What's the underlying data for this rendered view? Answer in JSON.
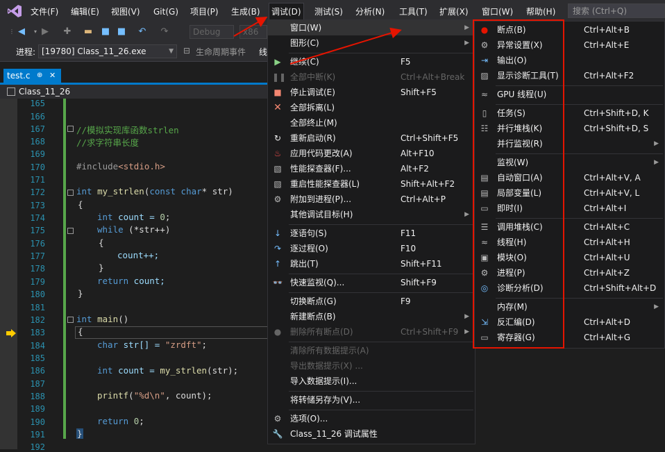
{
  "menubar": {
    "items": [
      "文件(F)",
      "编辑(E)",
      "视图(V)",
      "Git(G)",
      "项目(P)",
      "生成(B)",
      "调试(D)",
      "测试(S)",
      "分析(N)",
      "工具(T)",
      "扩展(X)",
      "窗口(W)",
      "帮助(H)"
    ],
    "search_placeholder": "搜索 (Ctrl+Q)"
  },
  "toolbar": {
    "config": "Debug",
    "platform": "x86",
    "process_label": "进程:",
    "process_value": "[19780] Class_11_26.exe",
    "lifecycle": "生命周期事件",
    "thread_label": "线"
  },
  "editor": {
    "tab_name": "test.c",
    "pin": "⊕",
    "close": "✕",
    "scope": "Class_11_26",
    "line_numbers": [
      "165",
      "166",
      "167",
      "168",
      "169",
      "170",
      "171",
      "172",
      "173",
      "174",
      "175",
      "176",
      "177",
      "178",
      "179",
      "180",
      "181",
      "182",
      "183",
      "184",
      "185",
      "186",
      "187",
      "188",
      "189",
      "190",
      "191",
      "192"
    ],
    "code": {
      "l167": "//模拟实现库函数strlen",
      "l168": "//求字符串长度",
      "l170_a": "#include",
      "l170_b": "<stdio.h>",
      "l172_kw": "int",
      "l172_fn": " my_strlen",
      "l172_rest": "(",
      "l172_kw2": "const",
      "l172_kw3": " char",
      "l172_end": "* str)",
      "l173": "{",
      "l174_kw": "int",
      "l174_rest": " count = ",
      "l174_num": "0",
      "l174_end": ";",
      "l175_kw": "while",
      "l175_rest": " (*str++)",
      "l176": "{",
      "l177": "count++;",
      "l178": "}",
      "l179_kw": "return",
      "l179_rest": " count;",
      "l180": "}",
      "l182_kw": "int",
      "l182_fn": " main",
      "l182_rest": "()",
      "l183": "{",
      "l184_kw": "char",
      "l184_rest": " str[] = ",
      "l184_str": "\"zrdft\"",
      "l184_end": ";",
      "l186_kw": "int",
      "l186_rest": " count = ",
      "l186_fn": "my_strlen",
      "l186_end": "(str);",
      "l188_fn": "printf",
      "l188_a": "(",
      "l188_str": "\"%d\\n\"",
      "l188_end": ", count);",
      "l190_kw": "return",
      "l190_rest": " ",
      "l190_num": "0",
      "l190_end": ";",
      "l191": "}"
    }
  },
  "debug_menu": {
    "items": [
      {
        "label": "窗口(W)",
        "shortcut": "",
        "icon": "",
        "submenu": true,
        "state": "highlighted"
      },
      {
        "label": "图形(C)",
        "shortcut": "",
        "icon": "",
        "submenu": true,
        "state": "normal"
      },
      {
        "label": "继续(C)",
        "shortcut": "F5",
        "icon": "play-icon",
        "state": "normal"
      },
      {
        "label": "全部中断(K)",
        "shortcut": "Ctrl+Alt+Break",
        "icon": "pause-icon",
        "state": "disabled"
      },
      {
        "label": "停止调试(E)",
        "shortcut": "Shift+F5",
        "icon": "stop-icon",
        "state": "normal"
      },
      {
        "label": "全部拆离(L)",
        "shortcut": "",
        "icon": "detach-icon",
        "state": "normal"
      },
      {
        "label": "全部终止(M)",
        "shortcut": "",
        "icon": "",
        "state": "normal"
      },
      {
        "label": "重新启动(R)",
        "shortcut": "Ctrl+Shift+F5",
        "icon": "restart-icon",
        "state": "normal"
      },
      {
        "label": "应用代码更改(A)",
        "shortcut": "Alt+F10",
        "icon": "hot-reload-icon",
        "state": "normal"
      },
      {
        "label": "性能探查器(F)...",
        "shortcut": "Alt+F2",
        "icon": "profiler-icon",
        "state": "normal"
      },
      {
        "label": "重启性能探查器(L)",
        "shortcut": "Shift+Alt+F2",
        "icon": "profiler-restart-icon",
        "state": "normal"
      },
      {
        "label": "附加到进程(P)...",
        "shortcut": "Ctrl+Alt+P",
        "icon": "attach-icon",
        "state": "normal"
      },
      {
        "label": "其他调试目标(H)",
        "shortcut": "",
        "icon": "",
        "submenu": true,
        "state": "normal"
      },
      {
        "label": "逐语句(S)",
        "shortcut": "F11",
        "icon": "step-into-icon",
        "state": "normal"
      },
      {
        "label": "逐过程(O)",
        "shortcut": "F10",
        "icon": "step-over-icon",
        "state": "normal"
      },
      {
        "label": "跳出(T)",
        "shortcut": "Shift+F11",
        "icon": "step-out-icon",
        "state": "normal"
      },
      {
        "label": "快速监视(Q)...",
        "shortcut": "Shift+F9",
        "icon": "quickwatch-icon",
        "state": "normal"
      },
      {
        "label": "切换断点(G)",
        "shortcut": "F9",
        "icon": "",
        "state": "normal"
      },
      {
        "label": "新建断点(B)",
        "shortcut": "",
        "icon": "",
        "submenu": true,
        "state": "normal"
      },
      {
        "label": "删除所有断点(D)",
        "shortcut": "Ctrl+Shift+F9",
        "icon": "delete-breakpoints-icon",
        "state": "disabled"
      },
      {
        "label": "清除所有数据提示(A)",
        "shortcut": "",
        "icon": "",
        "state": "disabled"
      },
      {
        "label": "导出数据提示(X) ...",
        "shortcut": "",
        "icon": "",
        "state": "disabled"
      },
      {
        "label": "导入数据提示(I)...",
        "shortcut": "",
        "icon": "",
        "state": "normal"
      },
      {
        "label": "将转储另存为(V)...",
        "shortcut": "",
        "icon": "",
        "state": "normal"
      },
      {
        "label": "选项(O)...",
        "shortcut": "",
        "icon": "gear-icon",
        "state": "normal"
      },
      {
        "label": "Class_11_26 调试属性",
        "shortcut": "",
        "icon": "wrench-icon",
        "state": "normal"
      }
    ]
  },
  "window_submenu": {
    "items": [
      {
        "label": "断点(B)",
        "shortcut": "Ctrl+Alt+B",
        "icon": "breakpoints-icon"
      },
      {
        "label": "异常设置(X)",
        "shortcut": "Ctrl+Alt+E",
        "icon": "exception-settings-icon"
      },
      {
        "label": "输出(O)",
        "shortcut": "",
        "icon": "output-icon"
      },
      {
        "label": "显示诊断工具(T)",
        "shortcut": "Ctrl+Alt+F2",
        "icon": "diagnostic-tools-icon"
      },
      {
        "label": "GPU 线程(U)",
        "shortcut": "",
        "icon": "gpu-threads-icon"
      },
      {
        "label": "任务(S)",
        "shortcut": "Ctrl+Shift+D, K",
        "icon": "tasks-icon"
      },
      {
        "label": "并行堆栈(K)",
        "shortcut": "Ctrl+Shift+D, S",
        "icon": "parallel-stacks-icon"
      },
      {
        "label": "并行监视(R)",
        "shortcut": "",
        "icon": "",
        "submenu": true
      },
      {
        "label": "监视(W)",
        "shortcut": "",
        "icon": "",
        "submenu": true
      },
      {
        "label": "自动窗口(A)",
        "shortcut": "Ctrl+Alt+V, A",
        "icon": "autos-icon"
      },
      {
        "label": "局部变量(L)",
        "shortcut": "Ctrl+Alt+V, L",
        "icon": "locals-icon"
      },
      {
        "label": "即时(I)",
        "shortcut": "Ctrl+Alt+I",
        "icon": "immediate-icon"
      },
      {
        "label": "调用堆栈(C)",
        "shortcut": "Ctrl+Alt+C",
        "icon": "call-stack-icon"
      },
      {
        "label": "线程(H)",
        "shortcut": "Ctrl+Alt+H",
        "icon": "threads-icon"
      },
      {
        "label": "模块(O)",
        "shortcut": "Ctrl+Alt+U",
        "icon": "modules-icon"
      },
      {
        "label": "进程(P)",
        "shortcut": "Ctrl+Alt+Z",
        "icon": "processes-icon"
      },
      {
        "label": "诊断分析(D)",
        "shortcut": "Ctrl+Shift+Alt+D",
        "icon": "diagnostic-analysis-icon"
      },
      {
        "label": "内存(M)",
        "shortcut": "",
        "icon": "",
        "submenu": true
      },
      {
        "label": "反汇编(D)",
        "shortcut": "Ctrl+Alt+D",
        "icon": "disassembly-icon"
      },
      {
        "label": "寄存器(G)",
        "shortcut": "Ctrl+Alt+G",
        "icon": "registers-icon"
      }
    ]
  },
  "colors": {
    "accent": "#007acc",
    "highlight_box": "#e51400",
    "annotation_arrow": "#e51400"
  }
}
